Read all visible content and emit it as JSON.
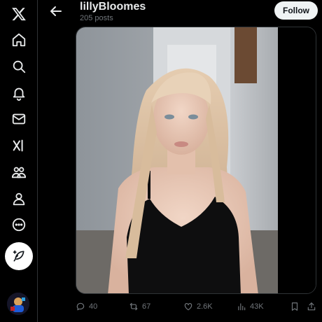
{
  "sidebar": {
    "items": [
      {
        "name": "x-logo-icon"
      },
      {
        "name": "home-icon"
      },
      {
        "name": "search-icon"
      },
      {
        "name": "bell-icon"
      },
      {
        "name": "mail-icon"
      },
      {
        "name": "grok-icon"
      },
      {
        "name": "communities-icon"
      },
      {
        "name": "profile-icon"
      },
      {
        "name": "more-icon"
      }
    ],
    "post_icon": "feather-icon"
  },
  "header": {
    "name": "lillyBloomes",
    "posts": "205 posts",
    "follow": "Follow"
  },
  "actions": {
    "replies": "40",
    "reposts": "67",
    "likes": "2.6K",
    "views": "43K"
  },
  "colors": {
    "background": "#000000",
    "text": "#e7e9ea",
    "muted": "#71767b",
    "border": "#2f3336",
    "follow_bg": "#eff3f4"
  }
}
